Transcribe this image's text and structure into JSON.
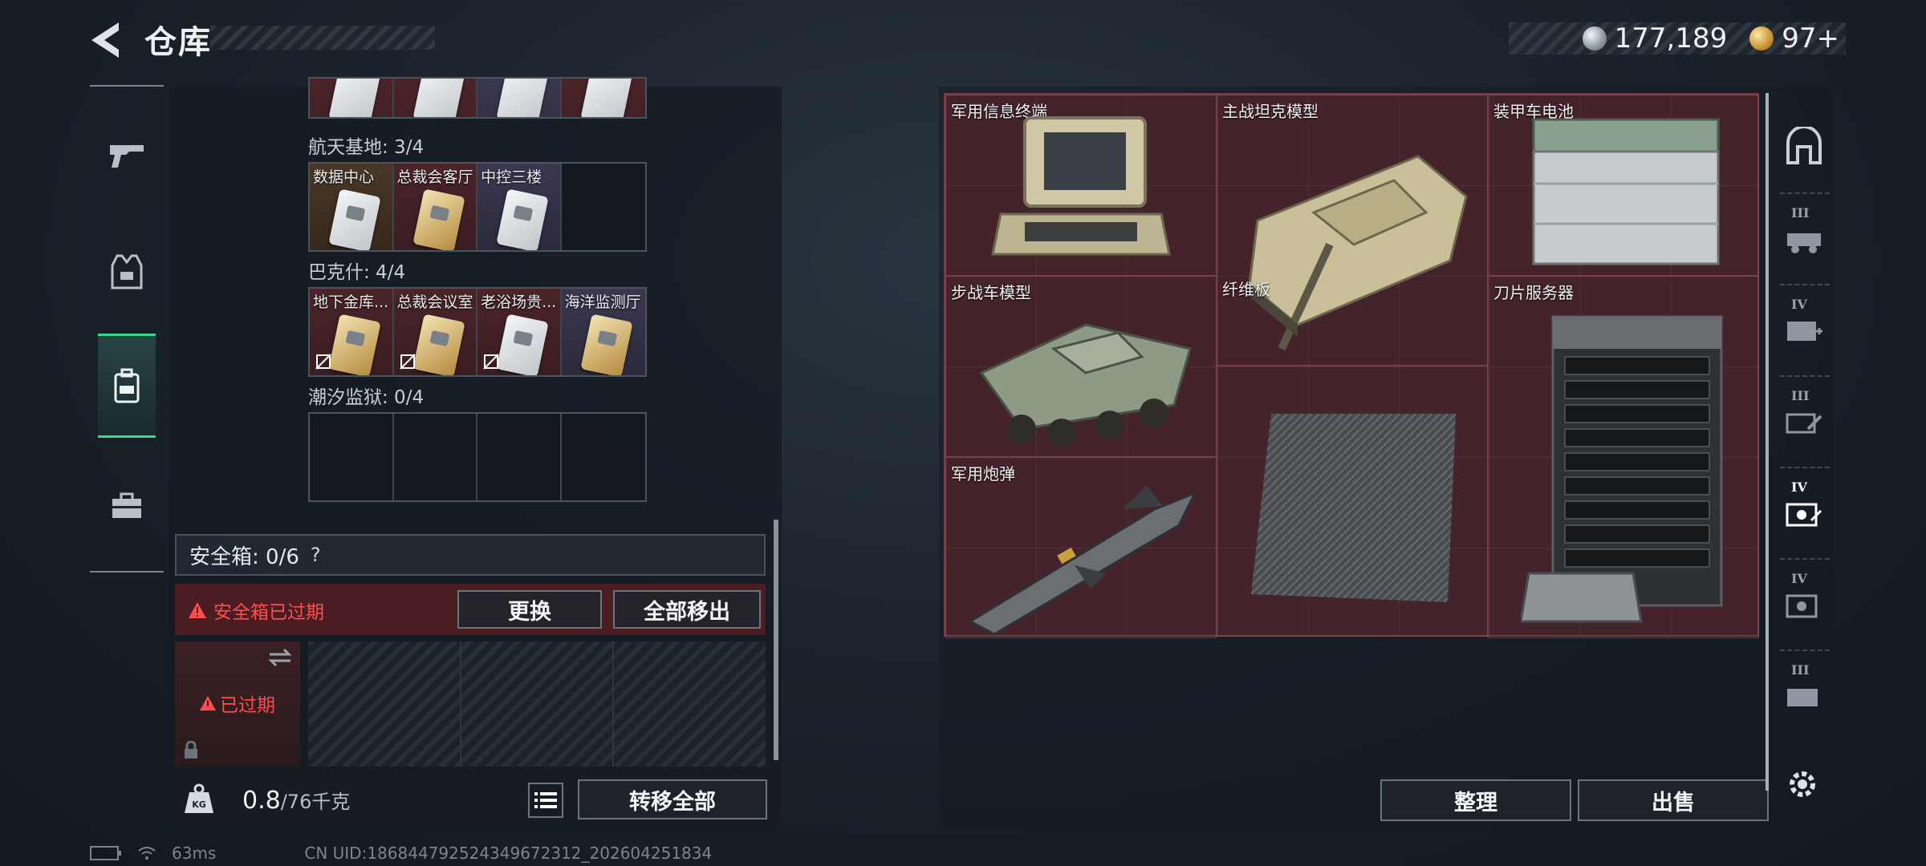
{
  "header": {
    "title": "仓库",
    "currency": [
      {
        "icon": "silver-coin-icon",
        "value": "177,189"
      },
      {
        "icon": "gold-coin-icon",
        "value": "97+"
      }
    ]
  },
  "left_tabs": [
    {
      "icon": "gun-icon"
    },
    {
      "icon": "armor-vest-icon"
    },
    {
      "icon": "backpack-icon",
      "active": true
    },
    {
      "icon": "toolbox-icon"
    }
  ],
  "collections": [
    {
      "label": "",
      "slots": [
        {
          "name": "",
          "rarity": "red"
        },
        {
          "name": "",
          "rarity": "red"
        },
        {
          "name": "",
          "rarity": "purple"
        },
        {
          "name": "",
          "rarity": "red"
        }
      ]
    },
    {
      "label": "航天基地: 3/4",
      "slots": [
        {
          "name": "数据中心",
          "rarity": "brown"
        },
        {
          "name": "总裁会客厅",
          "rarity": "red"
        },
        {
          "name": "中控三楼",
          "rarity": "purple"
        },
        {
          "name": "",
          "rarity": "empty"
        }
      ]
    },
    {
      "label": "巴克什: 4/4",
      "slots": [
        {
          "name": "地下金库...",
          "rarity": "red"
        },
        {
          "name": "总裁会议室",
          "rarity": "red"
        },
        {
          "name": "老浴场贵...",
          "rarity": "red"
        },
        {
          "name": "海洋监测厅",
          "rarity": "purple"
        }
      ]
    },
    {
      "label": "潮汐监狱: 0/4",
      "slots": [
        {
          "name": "",
          "rarity": "empty"
        },
        {
          "name": "",
          "rarity": "empty"
        },
        {
          "name": "",
          "rarity": "empty"
        },
        {
          "name": "",
          "rarity": "empty"
        }
      ]
    }
  ],
  "safebox": {
    "label": "安全箱: 0/6",
    "help": "?",
    "expired_notice": "安全箱已过期",
    "replace_label": "更换",
    "remove_all_label": "全部移出",
    "slot_status": "已过期"
  },
  "weight": {
    "current": "0.8",
    "max": "/76千克",
    "unit_icon": "kg-weight-icon"
  },
  "transfer_all_label": "转移全部",
  "items": [
    {
      "name": "军用信息终端"
    },
    {
      "name": "主战坦克模型"
    },
    {
      "name": "装甲车电池"
    },
    {
      "name": "步战车模型"
    },
    {
      "name": "刀片服务器"
    },
    {
      "name": "纤维板"
    },
    {
      "name": "军用炮弹"
    }
  ],
  "actions": {
    "sort_label": "整理",
    "sell_label": "出售"
  },
  "right_tabs": [
    {
      "icon": "all-items-icon",
      "tier": ""
    },
    {
      "icon": "vehicle-icon",
      "tier": "III"
    },
    {
      "icon": "medical-icon",
      "tier": "IV"
    },
    {
      "icon": "tools-icon",
      "tier": "III"
    },
    {
      "icon": "electronics-icon",
      "tier": "IV",
      "active": true
    },
    {
      "icon": "electronics-icon",
      "tier": "IV"
    },
    {
      "icon": "electronics-icon",
      "tier": "III"
    }
  ],
  "status": {
    "ping": "63ms",
    "uid": "CN UID:18684479252434967231​2_202604251834"
  }
}
